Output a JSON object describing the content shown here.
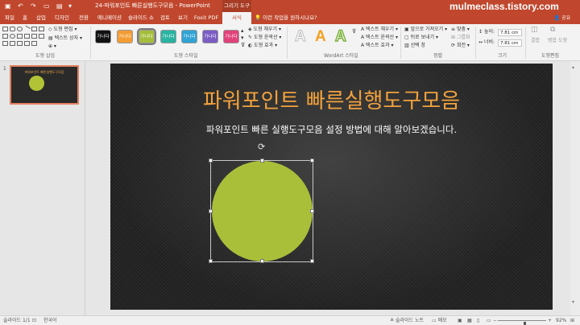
{
  "title_bar": {
    "document_title": "24-파워포인트 빠른실행도구모음 - PowerPoint",
    "context_tab": "그리기 도구",
    "watermark": "mulmeclass.tistory.com"
  },
  "tabs": [
    {
      "label": "파일",
      "active": false
    },
    {
      "label": "홈",
      "active": false
    },
    {
      "label": "삽입",
      "active": false
    },
    {
      "label": "디자인",
      "active": false
    },
    {
      "label": "전환",
      "active": false
    },
    {
      "label": "애니메이션",
      "active": false
    },
    {
      "label": "슬라이드 쇼",
      "active": false
    },
    {
      "label": "검토",
      "active": false
    },
    {
      "label": "보기",
      "active": false
    },
    {
      "label": "Foxit PDF",
      "active": false
    },
    {
      "label": "서식",
      "active": true
    }
  ],
  "tell_me": "이런 작업을 원하시나요?",
  "share": "공유",
  "ribbon": {
    "insert_shapes": {
      "label": "도형 삽입",
      "edit_shape": "도형 편집",
      "text_box": "텍스트 상자"
    },
    "shape_styles": {
      "label": "도형 스타일",
      "swatches": [
        {
          "text": "가나다",
          "color": "#111111"
        },
        {
          "text": "가나다",
          "color": "#f39c33"
        },
        {
          "text": "가나다",
          "color": "#a4bd3a"
        },
        {
          "text": "가나다",
          "color": "#29b3a1"
        },
        {
          "text": "가나다",
          "color": "#31a3d4"
        },
        {
          "text": "가나다",
          "color": "#7b5cc4"
        },
        {
          "text": "가나다",
          "color": "#e0427a"
        }
      ],
      "fill": "도형 채우기",
      "outline": "도형 윤곽선",
      "effects": "도형 효과"
    },
    "wordart": {
      "label": "WordArt 스타일",
      "text_fill": "텍스트 채우기",
      "text_outline": "텍스트 윤곽선",
      "text_effects": "텍스트 효과"
    },
    "arrange": {
      "label": "정렬",
      "bring_forward": "앞으로 가져오기",
      "send_backward": "뒤로 보내기",
      "selection_pane": "선택 창",
      "align": "맞춤",
      "group": "그룹화",
      "rotate": "회전"
    },
    "size": {
      "label": "크기",
      "height_label": "높이:",
      "height_value": "7.81 cm",
      "width_label": "너비:",
      "width_value": "7.81 cm"
    },
    "shape_edit": {
      "label": "도형편집",
      "merge": "결합",
      "merge_shapes": "병합 도형"
    }
  },
  "slides_pane": {
    "slide_number": "1",
    "thumb_title": "파워포인트 빠른실행도구모음"
  },
  "slide": {
    "title": "파워포인트 빠른실행도구모음",
    "subtitle": "파워포인트 빠른 실행도구모음 설정 방법에 대해 알아보겠습니다.",
    "circle_color": "#a9bf3a",
    "title_color": "#f2a23d"
  },
  "status_bar": {
    "slide_info": "슬라이드 1/1",
    "language": "한국어",
    "notes": "슬라이드 노트",
    "comments": "메모",
    "zoom": "92%",
    "zoom_fraction": 0.55
  }
}
